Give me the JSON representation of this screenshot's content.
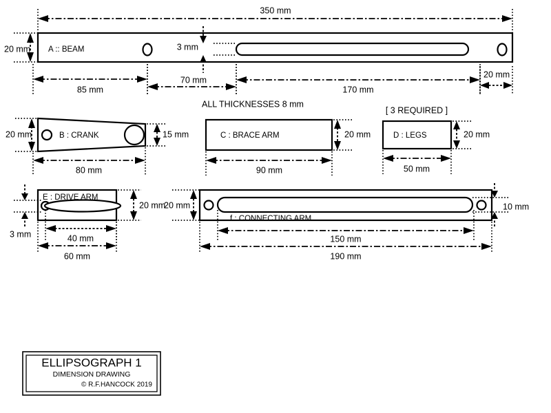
{
  "document": {
    "title": "ELLIPSOGRAPH 1",
    "subtitle": "DIMENSION DRAWING",
    "copyright": "© R.F.HANCOCK 2019"
  },
  "notes": {
    "thickness": "ALL THICKNESSES 8 mm",
    "legs_qty": "[ 3 REQUIRED ]"
  },
  "parts": {
    "beam": {
      "label": "A :: BEAM",
      "dims": {
        "overall_length": "350 mm",
        "height": "20 mm",
        "hole_to_left": "85 mm",
        "hole_to_slot": "70 mm",
        "slot_length": "170 mm",
        "right_end": "20 mm",
        "slot_edge_offset": "3 mm"
      }
    },
    "crank": {
      "label": "B  : CRANK",
      "dims": {
        "length": "80 mm",
        "height_left": "20 mm",
        "height_right": "15 mm"
      }
    },
    "brace_arm": {
      "label": "C  : BRACE ARM",
      "dims": {
        "length": "90 mm",
        "height": "20 mm"
      }
    },
    "legs": {
      "label": "D  : LEGS",
      "dims": {
        "length": "50 mm",
        "height": "20 mm"
      }
    },
    "drive_arm": {
      "label": "E   : DRIVE ARM",
      "dims": {
        "overall_length": "60 mm",
        "slot_length": "40 mm",
        "height": "20 mm",
        "edge_offset": "3 mm"
      }
    },
    "connecting_arm": {
      "label": "f : CONNECTING ARM",
      "dims": {
        "overall_length": "190 mm",
        "slot_length": "150 mm",
        "height": "20 mm",
        "slot_width": "10 mm"
      }
    }
  },
  "colors": {
    "line": "#000000",
    "background": "#ffffff"
  }
}
